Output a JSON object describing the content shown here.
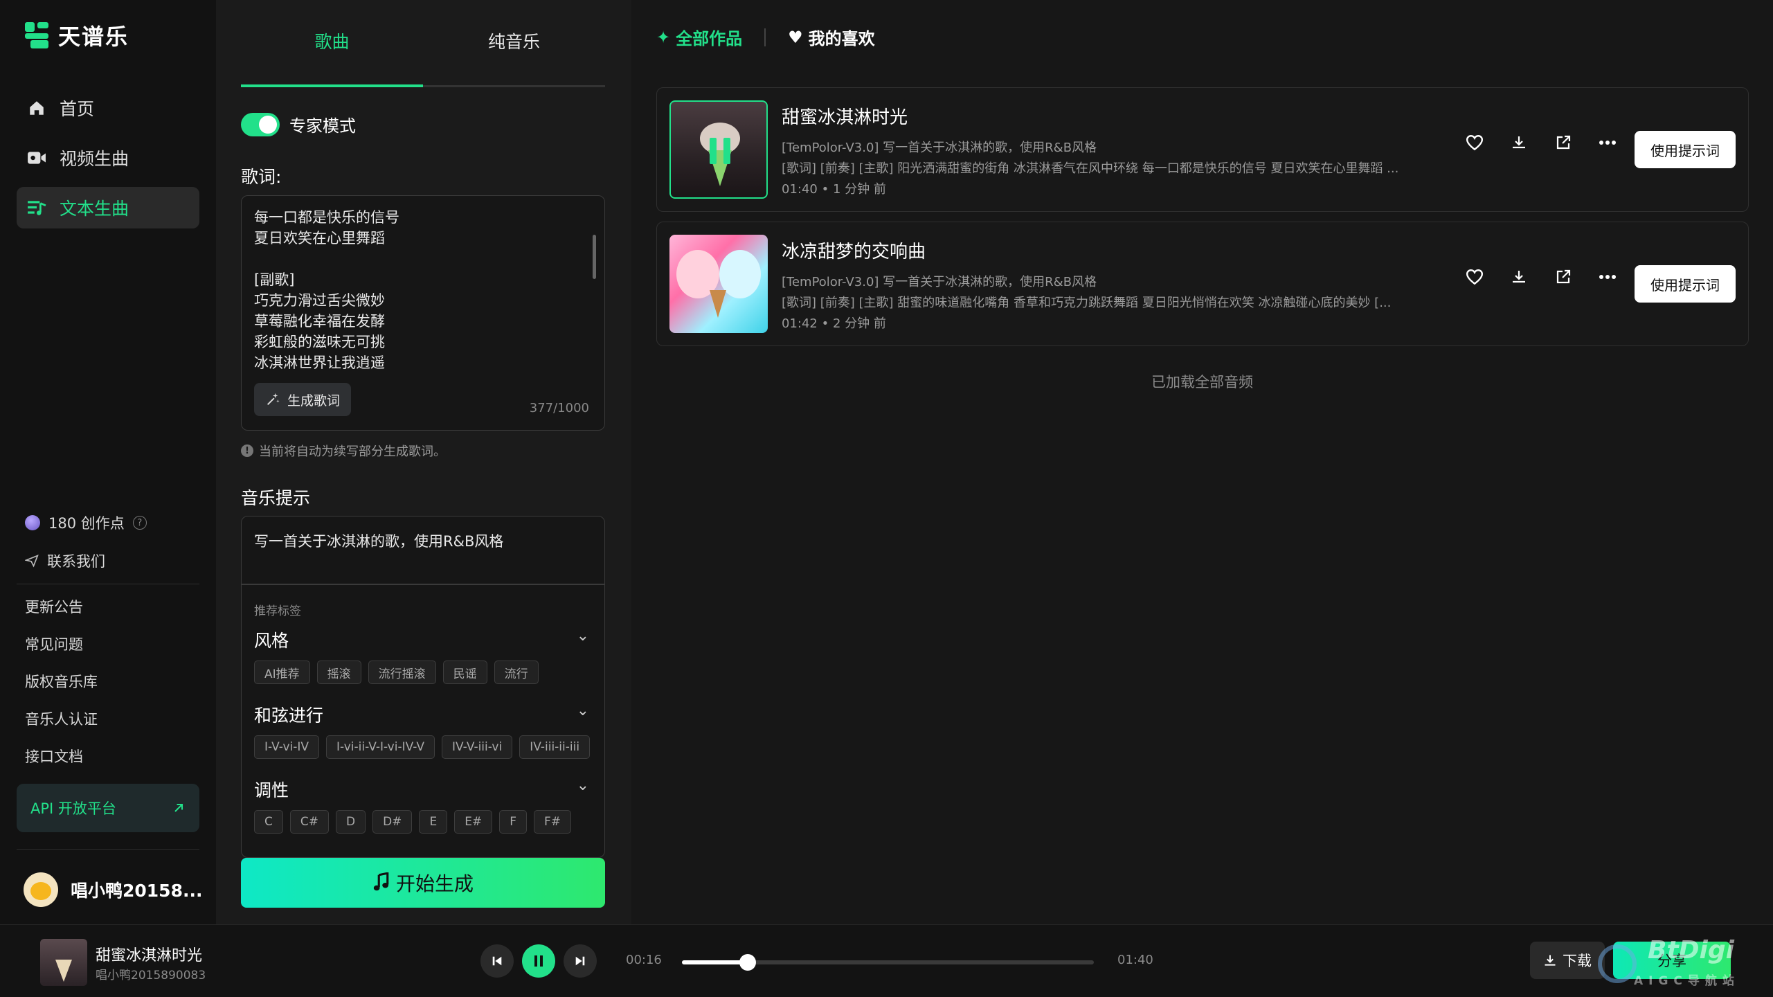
{
  "app": {
    "name": "天谱乐",
    "brand_color": "#22e08a"
  },
  "sidebar": {
    "nav": [
      {
        "label": "首页",
        "icon": "home-icon"
      },
      {
        "label": "视频生曲",
        "icon": "video-icon"
      },
      {
        "label": "文本生曲",
        "icon": "text-music-icon",
        "active": true
      }
    ],
    "credits": "180 创作点",
    "contact": "联系我们",
    "links": [
      "更新公告",
      "常见问题",
      "版权音乐库",
      "音乐人认证",
      "接口文档"
    ],
    "api_button": "API 开放平台",
    "user_name": "唱小鸭20158..."
  },
  "panel": {
    "tabs": [
      "歌曲",
      "纯音乐"
    ],
    "expert_mode": "专家模式",
    "lyrics_label": "歌词:",
    "lyrics_text": "每一口都是快乐的信号\n夏日欢笑在心里舞蹈\n\n[副歌]\n巧克力滑过舌尖微妙\n草莓融化幸福在发酵\n彩虹般的滋味无可挑\n冰淇淋世界让我逍遥",
    "generate_lyrics": "生成歌词",
    "counter": "377/1000",
    "hint": "当前将自动为续写部分生成歌词。",
    "prompt_label": "音乐提示",
    "prompt_text": "写一首关于冰淇淋的歌，使用R&B风格",
    "recommend_label": "推荐标签",
    "groups": [
      {
        "title": "风格",
        "chips": [
          "AI推荐",
          "摇滚",
          "流行摇滚",
          "民谣",
          "流行"
        ]
      },
      {
        "title": "和弦进行",
        "chips": [
          "I-V-vi-IV",
          "I-vi-ii-V-I-vi-IV-V",
          "IV-V-iii-vi",
          "IV-iii-ii-iii"
        ]
      },
      {
        "title": "调性",
        "chips": [
          "C",
          "C#",
          "D",
          "D#",
          "E",
          "E#",
          "F",
          "F#"
        ]
      }
    ],
    "start_button": "开始生成"
  },
  "content": {
    "tabs": [
      "全部作品",
      "我的喜欢"
    ],
    "songs": [
      {
        "title": "甜蜜冰淇淋时光",
        "prompt": "[TemPolor-V3.0] 写一首关于冰淇淋的歌，使用R&B风格",
        "lyrics_preview": "[歌词] [前奏] [主歌] 阳光洒满甜蜜的街角 冰淇淋香气在风中环绕 每一口都是快乐的信号 夏日欢笑在心里舞蹈 ...",
        "duration": "01:40",
        "time_ago": "1 分钟 前",
        "use_prompt": "使用提示词",
        "playing": true
      },
      {
        "title": "冰凉甜梦的交响曲",
        "prompt": "[TemPolor-V3.0] 写一首关于冰淇淋的歌，使用R&B风格",
        "lyrics_preview": "[歌词] [前奏] [主歌] 甜蜜的味道融化嘴角 香草和巧克力跳跃舞蹈 夏日阳光悄悄在欢笑 冰凉触碰心底的美妙 [...",
        "duration": "01:42",
        "time_ago": "2 分钟 前",
        "use_prompt": "使用提示词",
        "playing": false
      }
    ],
    "loaded_text": "已加载全部音频"
  },
  "player": {
    "title": "甜蜜冰淇淋时光",
    "artist": "唱小鸭2015890083",
    "current_time": "00:16",
    "total_time": "01:40",
    "progress_fraction": 0.16,
    "download": "下载",
    "share": "分享"
  },
  "watermark": {
    "main": "BtDigi",
    "sub": "AIGC导航站"
  }
}
